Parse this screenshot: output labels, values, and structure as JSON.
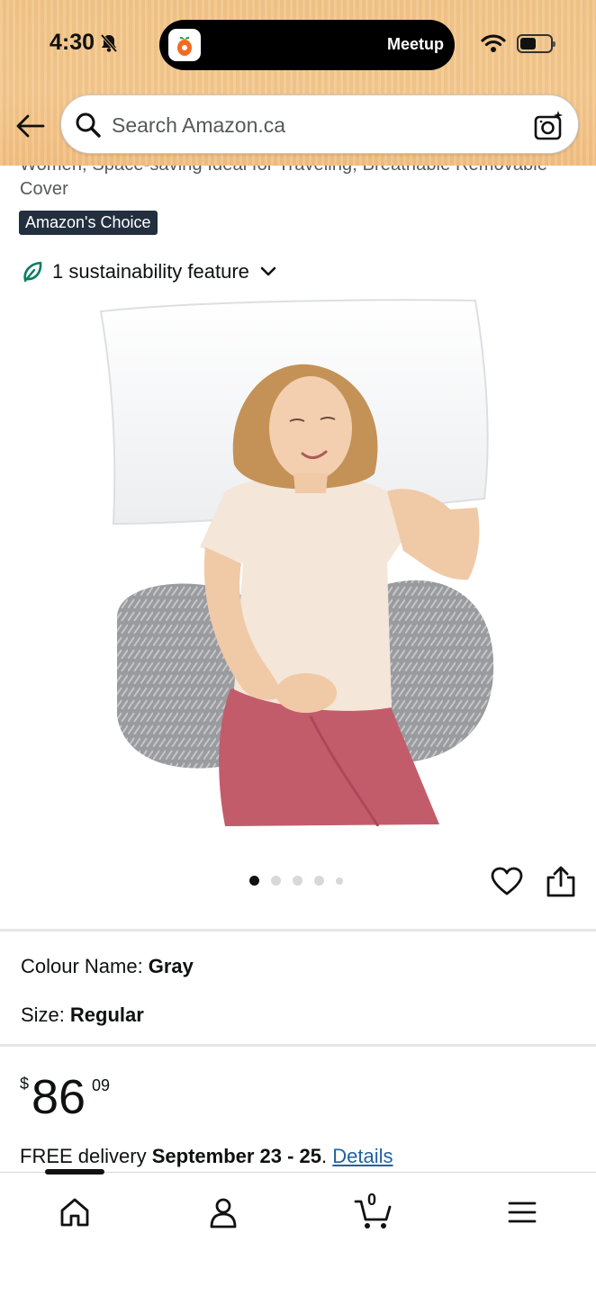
{
  "status_bar": {
    "time": "4:30",
    "live_activity_label": "Meetup"
  },
  "search": {
    "placeholder": "Search Amazon.ca"
  },
  "product": {
    "title_fragment": "Women, Space-saving Ideal for Traveling, Breathable Removable Cover",
    "badge": "Amazon's Choice",
    "sustainability": "1 sustainability feature",
    "image_count": 5,
    "active_image": 1
  },
  "variations": {
    "colour_label": "Colour Name:",
    "colour_value": "Gray",
    "size_label": "Size:",
    "size_value": "Regular"
  },
  "price": {
    "symbol": "$",
    "whole": "86",
    "fraction": "09"
  },
  "delivery": {
    "prefix": "FREE delivery",
    "dates": "September 23 - 25",
    "suffix": ".",
    "details_link": "Details"
  },
  "bottom_nav": {
    "cart_count": "0",
    "icons": [
      "home-icon",
      "account-icon",
      "cart-icon",
      "menu-icon"
    ]
  },
  "colors": {
    "header_bg": "#f3c586",
    "badge_bg": "#232f3e",
    "link": "#2162a1",
    "leaf": "#067d62"
  }
}
